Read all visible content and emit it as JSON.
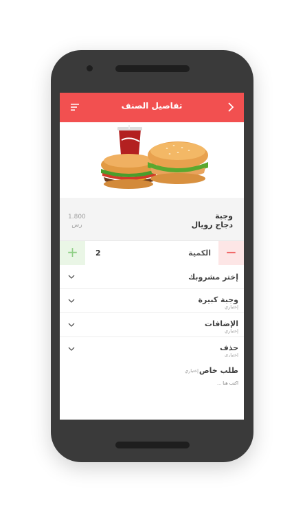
{
  "header": {
    "title": "تفاصيل الصنف"
  },
  "item": {
    "name_line1": "وجبة",
    "name_line2": "دجاج رويال",
    "price": "1.800",
    "currency": "رس"
  },
  "quantity": {
    "label": "الكمية",
    "value": "2",
    "plus": "+",
    "minus": "−"
  },
  "options": [
    {
      "title": "إختر مشروبك",
      "subtitle": ""
    },
    {
      "title": "وجبة كبيرة",
      "subtitle": "إختياري"
    },
    {
      "title": "الإضافات",
      "subtitle": "إختياري"
    },
    {
      "title": "حذف",
      "subtitle": "إختياري"
    }
  ],
  "special_request": {
    "title": "طلب خاص",
    "subtitle": "إختياري",
    "placeholder": "اكتب هنا ..."
  },
  "colors": {
    "accent": "#f25050",
    "plus_bg": "#eaf6e6",
    "minus_bg": "#fde6e6",
    "phone_body": "#3a3a3a"
  }
}
